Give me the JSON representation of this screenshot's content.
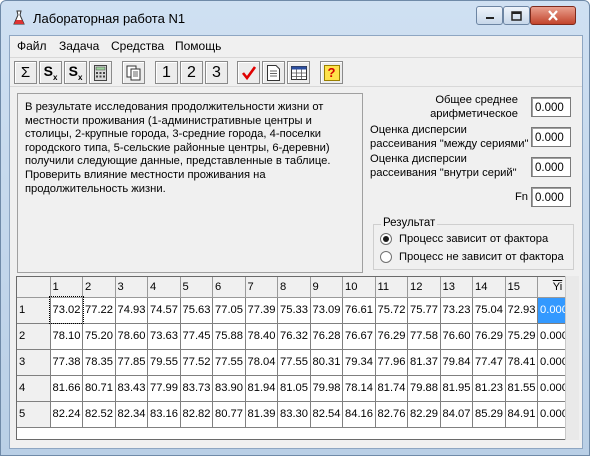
{
  "window": {
    "title": "Лабораторная работа N1"
  },
  "menu": [
    "Файл",
    "Задача",
    "Средства",
    "Помощь"
  ],
  "toolbar": {
    "sum_glyph": "Σ",
    "sx_glyph": "S",
    "numbers": [
      "1",
      "2",
      "3"
    ],
    "help_glyph": "?"
  },
  "description": "В результате исследования продолжительности жизни от местности проживания (1-административные центры и столицы, 2-крупные города, 3-средние города, 4-поселки городского типа, 5-сельские районные центры, 6-деревни) получили следующие данные, представленные в таблице. Проверить влияние местности проживания на продолжительность жизни.",
  "stats": {
    "mean_label": "Общее среднее\nарифметическое",
    "mean_value": "0.000",
    "between_label": "Оценка дисперсии\nрассеивания \"между сериями\"",
    "between_value": "0.000",
    "within_label": "Оценка дисперсии\nрассеивания \"внутри серий\"",
    "within_value": "0.000",
    "fn_label": "Fn",
    "fn_value": "0.000"
  },
  "result": {
    "legend": "Результат",
    "options": [
      "Процесс зависит от фактора",
      "Процесс не зависит от фактора"
    ],
    "selected": 0
  },
  "grid": {
    "columns": [
      "1",
      "2",
      "3",
      "4",
      "5",
      "6",
      "7",
      "8",
      "9",
      "10",
      "11",
      "12",
      "13",
      "14",
      "15"
    ],
    "yi_header": "Yi",
    "rows": [
      {
        "label": "1",
        "cells": [
          "73.02",
          "77.22",
          "74.93",
          "74.57",
          "75.63",
          "77.05",
          "77.39",
          "75.33",
          "73.09",
          "76.61",
          "75.72",
          "75.77",
          "73.23",
          "75.04",
          "72.93"
        ],
        "yi": "0.000"
      },
      {
        "label": "2",
        "cells": [
          "78.10",
          "75.20",
          "78.60",
          "73.63",
          "77.45",
          "75.88",
          "78.40",
          "76.32",
          "76.28",
          "76.67",
          "76.29",
          "77.58",
          "76.60",
          "76.29",
          "75.29"
        ],
        "yi": "0.000"
      },
      {
        "label": "3",
        "cells": [
          "77.38",
          "78.35",
          "77.85",
          "79.55",
          "77.52",
          "77.55",
          "78.04",
          "77.55",
          "80.31",
          "79.34",
          "77.96",
          "81.37",
          "79.84",
          "77.47",
          "78.41"
        ],
        "yi": "0.000"
      },
      {
        "label": "4",
        "cells": [
          "81.66",
          "80.71",
          "83.43",
          "77.99",
          "83.73",
          "83.90",
          "81.94",
          "81.05",
          "79.98",
          "78.14",
          "81.74",
          "79.88",
          "81.95",
          "81.23",
          "81.55"
        ],
        "yi": "0.000"
      },
      {
        "label": "5",
        "cells": [
          "82.24",
          "82.52",
          "82.34",
          "83.16",
          "82.82",
          "80.77",
          "81.39",
          "83.30",
          "82.54",
          "84.16",
          "82.76",
          "82.29",
          "84.07",
          "85.29",
          "84.91"
        ],
        "yi": "0.000"
      }
    ]
  }
}
